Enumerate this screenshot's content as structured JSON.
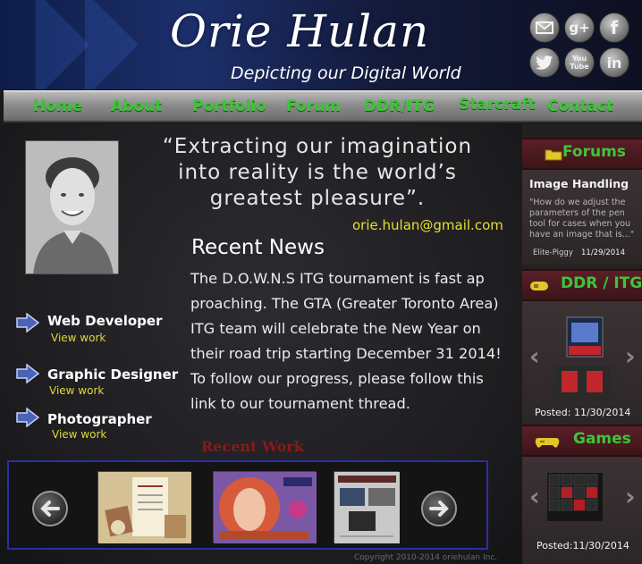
{
  "header": {
    "name": "Orie Hulan",
    "tagline": "Depicting our Digital World",
    "social": [
      "envelope-icon",
      "google-plus-icon",
      "facebook-icon",
      "twitter-icon",
      "youtube-icon",
      "linkedin-icon"
    ],
    "social_glyphs": {
      "gplus": "g+",
      "facebook": "f",
      "youtube": "You Tube",
      "linkedin": "in"
    }
  },
  "nav": [
    "Home",
    "About",
    "Portfolio",
    "Forum",
    "DDR/ITG",
    "Starcraft",
    "Contact"
  ],
  "quote": "“Extracting our imagination into reality is the world’s greatest pleasure”.",
  "email": "orie.hulan@gmail.com",
  "news": {
    "title": "Recent News",
    "body": "The D.O.W.N.S ITG tournament is fast ap proaching. The GTA (Greater Toronto Area) ITG team will celebrate the New Year on their road trip starting December 31 2014!  To follow our progress, please follow this link to our tournament thread."
  },
  "roles": [
    {
      "title": "Web Developer",
      "link": "View work"
    },
    {
      "title": "Graphic Designer",
      "link": "View work"
    },
    {
      "title": "Photographer",
      "link": "View work"
    }
  ],
  "recent_work": "Recent Work",
  "thumbs": [
    "Saturday Student Special",
    "Portrait artwork",
    "Magazine spread"
  ],
  "copyright": "Copyright 2010-2014 oriehulan Inc.",
  "sidebar": {
    "forums": {
      "title": "Forums",
      "post_title": "Image Handling",
      "excerpt": "\"How do we adjust the parameters of the pen tool for cases when you have an image that is...\"",
      "user": "Elite-Piggy",
      "date": "11/29/2014"
    },
    "ddr": {
      "title": "DDR / ITG",
      "posted": "Posted: 11/30/2014"
    },
    "games": {
      "title": "Games",
      "posted": "Posted:11/30/2014"
    }
  },
  "colors": {
    "nav_green": "#3fc43a",
    "email_yellow": "#e7df2e",
    "carousel_border": "#2a2ea8",
    "sidebar_header": "#5a1f27"
  }
}
